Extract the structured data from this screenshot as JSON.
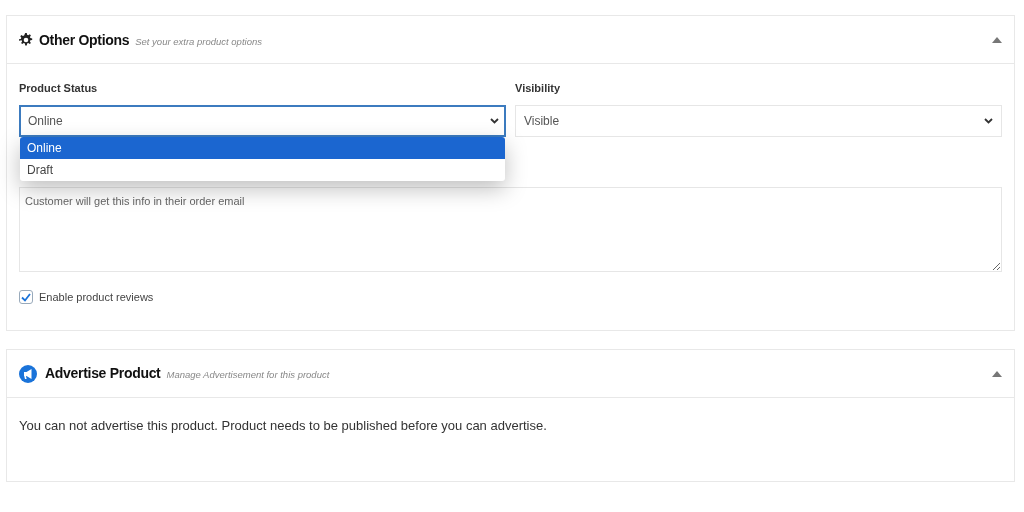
{
  "sections": [
    {
      "kind": "options",
      "title": "Other Options",
      "subtitle": "Set your extra product options",
      "expanded": true,
      "fields": [
        {
          "label": "Product Status",
          "value": "Online",
          "focused": true,
          "options": [
            {
              "label": "Online",
              "selected": true
            },
            {
              "label": "Draft",
              "selected": false
            }
          ]
        },
        {
          "label": "Visibility",
          "value": "Visible",
          "focused": false
        }
      ],
      "note": {
        "placeholder": "Customer will get this info in their order email"
      },
      "checkbox": {
        "label": "Enable product reviews",
        "checked": true
      }
    },
    {
      "kind": "advertise",
      "title": "Advertise Product",
      "subtitle": "Manage Advertisement for this product",
      "expanded": true,
      "message": "You can not advertise this product. Product needs to be published before you can advertise."
    }
  ]
}
